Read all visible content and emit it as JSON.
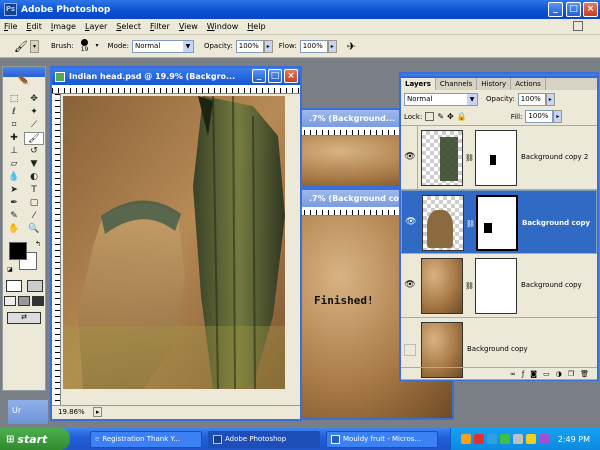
{
  "app": {
    "title": "Adobe Photoshop"
  },
  "menu": [
    "File",
    "Edit",
    "Image",
    "Layer",
    "Select",
    "Filter",
    "View",
    "Window",
    "Help"
  ],
  "options": {
    "brush_label": "Brush:",
    "brush_size": "19",
    "mode_label": "Mode:",
    "mode_value": "Normal",
    "opacity_label": "Opacity:",
    "opacity_value": "100%",
    "flow_label": "Flow:",
    "flow_value": "100%"
  },
  "documents": {
    "main_title": "Indian head.psd @ 19.9% (Backgro...",
    "back1_title": ".7% (Background...",
    "back2_title": ".7% (Background copy...",
    "zoom": "19.86%",
    "finished_text": "Finished!",
    "side_tab": "Ur"
  },
  "layers_panel": {
    "tabs": [
      "Layers",
      "Channels",
      "History",
      "Actions"
    ],
    "blend_mode": "Normal",
    "opacity_label": "Opacity:",
    "opacity_value": "100%",
    "lock_label": "Lock:",
    "fill_label": "Fill:",
    "fill_value": "100%",
    "layers": [
      {
        "name": "Background copy 2",
        "selected": false,
        "visible": true
      },
      {
        "name": "Background copy",
        "selected": true,
        "visible": true
      },
      {
        "name": "Background copy",
        "selected": false,
        "visible": true
      },
      {
        "name": "Background copy",
        "selected": false,
        "visible": false
      }
    ]
  },
  "taskbar": {
    "start": "start",
    "tasks": [
      "Registration Thank Y...",
      "Adobe Photoshop",
      "Mouldy fruit - Micros..."
    ],
    "clock": "2:49 PM"
  },
  "colors": {
    "titlebar": "#0a4fd3",
    "selection": "#316ac5",
    "taskbar": "#245edb",
    "start": "#2e8b2e"
  }
}
